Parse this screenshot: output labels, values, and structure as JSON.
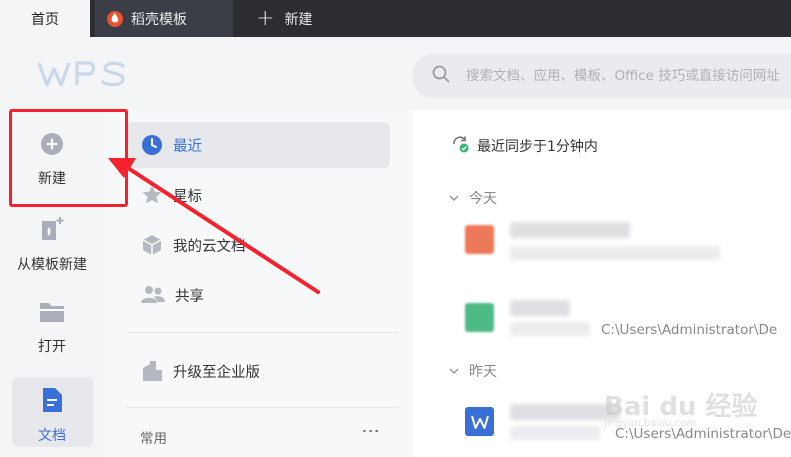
{
  "tabs": {
    "home": "首页",
    "docer": "稻壳模板",
    "new": "新建"
  },
  "header": {
    "logo_text": "WPS",
    "search_placeholder": "搜索文档、应用、模板、Office 技巧或直接访问网址"
  },
  "rail": {
    "new": "新建",
    "from_template": "从模板新建",
    "open": "打开",
    "docs": "文档"
  },
  "nav": {
    "recent": "最近",
    "starred": "星标",
    "cloud": "我的云文档",
    "shared": "共享",
    "upgrade": "升级至企业版",
    "common": "常用"
  },
  "main": {
    "sync_status": "最近同步于1分钟内",
    "today": "今天",
    "yesterday": "昨天",
    "file2_path": "C:\\Users\\Administrator\\De",
    "file3_path": "C:\\Users\\Administrator\\De"
  },
  "watermark": {
    "text": "Bai du 经验",
    "sub": "jingyan.baidu.com"
  },
  "colors": {
    "accent": "#3a6fd8",
    "highlight": "#f5222d",
    "docer": "#e9532f"
  }
}
